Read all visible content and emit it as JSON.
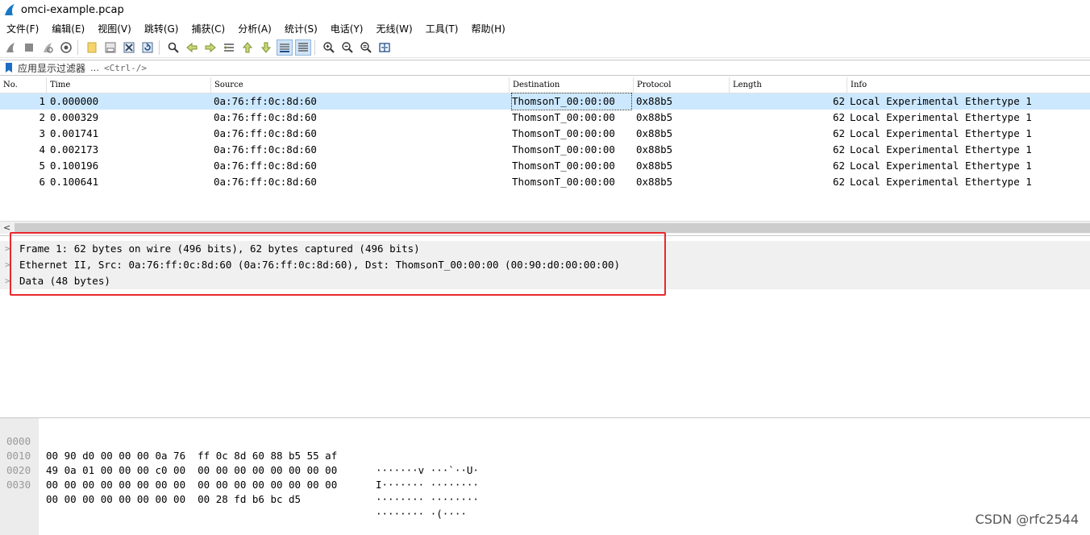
{
  "window": {
    "title": "omci-example.pcap"
  },
  "menu": [
    "文件(F)",
    "编辑(E)",
    "视图(V)",
    "跳转(G)",
    "捕获(C)",
    "分析(A)",
    "统计(S)",
    "电话(Y)",
    "无线(W)",
    "工具(T)",
    "帮助(H)"
  ],
  "toolbar_icons": [
    "start-capture-icon",
    "stop-capture-icon",
    "restart-capture-icon",
    "capture-options-icon",
    "open-file-icon",
    "save-file-icon",
    "close-file-icon",
    "reload-file-icon",
    "find-packet-icon",
    "go-back-icon",
    "go-forward-icon",
    "go-to-packet-icon",
    "first-packet-icon",
    "last-packet-icon",
    "auto-scroll-icon",
    "colorize-icon",
    "zoom-in-icon",
    "zoom-out-icon",
    "normal-size-icon",
    "resize-columns-icon"
  ],
  "filter": {
    "label": "应用显示过滤器",
    "arrow": "…",
    "hint": "<Ctrl-/>"
  },
  "packet_list": {
    "columns": [
      "No.",
      "Time",
      "Source",
      "Destination",
      "Protocol",
      "Length",
      "Info"
    ],
    "rows": [
      {
        "no": "1",
        "time": "0.000000",
        "source": "0a:76:ff:0c:8d:60",
        "destination": "ThomsonT_00:00:00",
        "protocol": "0x88b5",
        "length": "62",
        "info": "Local Experimental Ethertype 1"
      },
      {
        "no": "2",
        "time": "0.000329",
        "source": "0a:76:ff:0c:8d:60",
        "destination": "ThomsonT_00:00:00",
        "protocol": "0x88b5",
        "length": "62",
        "info": "Local Experimental Ethertype 1"
      },
      {
        "no": "3",
        "time": "0.001741",
        "source": "0a:76:ff:0c:8d:60",
        "destination": "ThomsonT_00:00:00",
        "protocol": "0x88b5",
        "length": "62",
        "info": "Local Experimental Ethertype 1"
      },
      {
        "no": "4",
        "time": "0.002173",
        "source": "0a:76:ff:0c:8d:60",
        "destination": "ThomsonT_00:00:00",
        "protocol": "0x88b5",
        "length": "62",
        "info": "Local Experimental Ethertype 1"
      },
      {
        "no": "5",
        "time": "0.100196",
        "source": "0a:76:ff:0c:8d:60",
        "destination": "ThomsonT_00:00:00",
        "protocol": "0x88b5",
        "length": "62",
        "info": "Local Experimental Ethertype 1"
      },
      {
        "no": "6",
        "time": "0.100641",
        "source": "0a:76:ff:0c:8d:60",
        "destination": "ThomsonT_00:00:00",
        "protocol": "0x88b5",
        "length": "62",
        "info": "Local Experimental Ethertype 1"
      }
    ],
    "selected_row": "1"
  },
  "details": [
    "Frame 1: 62 bytes on wire (496 bits), 62 bytes captured (496 bits)",
    "Ethernet II, Src: 0a:76:ff:0c:8d:60 (0a:76:ff:0c:8d:60), Dst: ThomsonT_00:00:00 (00:90:d0:00:00:00)",
    "Data (48 bytes)"
  ],
  "bytes": [
    {
      "offset": "0000",
      "hex": "00 90 d0 00 00 00 0a 76  ff 0c 8d 60 88 b5 55 af",
      "ascii": "·······v ···`··U·"
    },
    {
      "offset": "0010",
      "hex": "49 0a 01 00 00 00 c0 00  00 00 00 00 00 00 00 00",
      "ascii": "I······· ········"
    },
    {
      "offset": "0020",
      "hex": "00 00 00 00 00 00 00 00  00 00 00 00 00 00 00 00",
      "ascii": "········ ········"
    },
    {
      "offset": "0030",
      "hex": "00 00 00 00 00 00 00 00  00 28 fd b6 bc d5",
      "ascii": "········ ·(····"
    }
  ],
  "colors": {
    "selected_row": "#cce8ff",
    "highlight_box": "#e8282d",
    "details_bg": "#f0f0f0"
  },
  "watermark": "CSDN @rfc2544"
}
